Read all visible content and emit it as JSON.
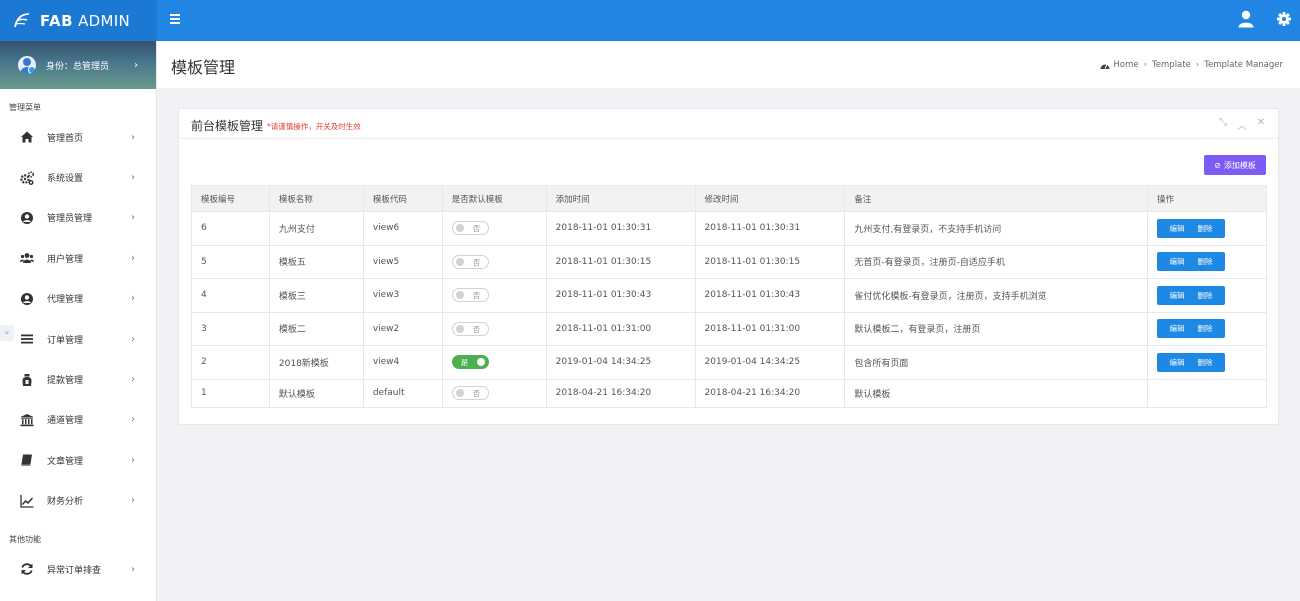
{
  "app": {
    "brand_bold": "FAB",
    "brand_light": "ADMIN"
  },
  "sidebar": {
    "identity": "身份：总管理员",
    "section_main": "管理菜单",
    "section_other": "其他功能",
    "items": [
      {
        "label": "管理首页",
        "icon": "home-icon"
      },
      {
        "label": "系统设置",
        "icon": "gears-icon"
      },
      {
        "label": "管理员管理",
        "icon": "user-circle-icon"
      },
      {
        "label": "用户管理",
        "icon": "users-icon"
      },
      {
        "label": "代理管理",
        "icon": "user-circle-icon"
      },
      {
        "label": "订单管理",
        "icon": "list-icon"
      },
      {
        "label": "提款管理",
        "icon": "money-bag-icon"
      },
      {
        "label": "通道管理",
        "icon": "bank-icon"
      },
      {
        "label": "文章管理",
        "icon": "book-icon"
      },
      {
        "label": "财务分析",
        "icon": "line-chart-icon"
      }
    ],
    "other_items": [
      {
        "label": "异常订单排查",
        "icon": "refresh-icon"
      }
    ]
  },
  "header": {
    "title": "模板管理",
    "breadcrumb": [
      "Home",
      "Template",
      "Template Manager"
    ]
  },
  "panel": {
    "title": "前台模板管理",
    "warning": "*请谨慎操作，开关及时生效",
    "add_button": "添加模板"
  },
  "table": {
    "headers": [
      "模板编号",
      "模板名称",
      "模板代码",
      "是否默认模板",
      "添加时间",
      "修改时间",
      "备注",
      "操作"
    ],
    "edit_label": "编辑",
    "delete_label": "删除",
    "rows": [
      {
        "id": "6",
        "name": "九州支付",
        "code": "view6",
        "default": "否",
        "added": "2018-11-01 01:30:31",
        "modified": "2018-11-01 01:30:31",
        "note": "九州支付,有登录页，不支持手机访问"
      },
      {
        "id": "5",
        "name": "模板五",
        "code": "view5",
        "default": "否",
        "added": "2018-11-01 01:30:15",
        "modified": "2018-11-01 01:30:15",
        "note": "无首页-有登录页，注册页-自适应手机"
      },
      {
        "id": "4",
        "name": "模板三",
        "code": "view3",
        "default": "否",
        "added": "2018-11-01 01:30:43",
        "modified": "2018-11-01 01:30:43",
        "note": "雀付优化模板-有登录页，注册页，支持手机浏览"
      },
      {
        "id": "3",
        "name": "模板二",
        "code": "view2",
        "default": "否",
        "added": "2018-11-01 01:31:00",
        "modified": "2018-11-01 01:31:00",
        "note": "默认模板二，有登录页，注册页"
      },
      {
        "id": "2",
        "name": "2018新模板",
        "code": "view4",
        "default": "是",
        "added": "2019-01-04 14:34:25",
        "modified": "2019-01-04 14:34:25",
        "note": "包含所有页面"
      },
      {
        "id": "1",
        "name": "默认模板",
        "code": "default",
        "default": "否",
        "added": "2018-04-21 16:34:20",
        "modified": "2018-04-21 16:34:20",
        "note": "默认模板"
      }
    ]
  },
  "colors": {
    "primary": "#2185e4",
    "brand_bg": "#1b78d3",
    "add_button": "#7d5cf6",
    "action_button": "#1e88e5",
    "toggle_on": "#4caf50",
    "warning": "#e53935"
  }
}
